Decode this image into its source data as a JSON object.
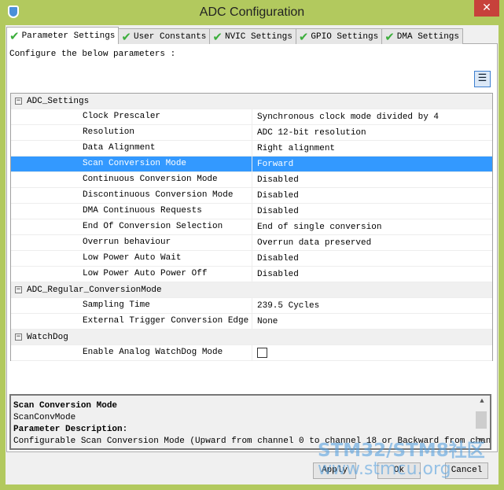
{
  "window": {
    "title": "ADC Configuration",
    "close": "✕"
  },
  "tabs": [
    {
      "label": "Parameter Settings"
    },
    {
      "label": "User Constants"
    },
    {
      "label": "NVIC Settings"
    },
    {
      "label": "GPIO Settings"
    },
    {
      "label": "DMA Settings"
    }
  ],
  "intro": "Configure the below parameters :",
  "groups": [
    {
      "name": "ADC_Settings",
      "params": [
        [
          "Clock Prescaler",
          "Synchronous clock mode divided by 4"
        ],
        [
          "Resolution",
          "ADC 12-bit resolution"
        ],
        [
          "Data Alignment",
          "Right alignment"
        ],
        [
          "Scan Conversion Mode",
          "Forward"
        ],
        [
          "Continuous Conversion Mode",
          "Disabled"
        ],
        [
          "Discontinuous Conversion Mode",
          "Disabled"
        ],
        [
          "DMA Continuous Requests",
          "Disabled"
        ],
        [
          "End Of Conversion Selection",
          "End of single conversion"
        ],
        [
          "Overrun behaviour",
          "Overrun data preserved"
        ],
        [
          "Low Power Auto Wait",
          "Disabled"
        ],
        [
          "Low Power Auto Power Off",
          "Disabled"
        ]
      ]
    },
    {
      "name": "ADC_Regular_ConversionMode",
      "params": [
        [
          "Sampling Time",
          "239.5 Cycles"
        ],
        [
          "External Trigger Conversion Edge",
          "None"
        ]
      ]
    },
    {
      "name": "WatchDog",
      "params": [
        [
          "Enable Analog WatchDog Mode",
          ""
        ]
      ]
    }
  ],
  "selected": "Scan Conversion Mode",
  "watchdog_checked": false,
  "description": {
    "title": "Scan Conversion Mode",
    "id": "ScanConvMode",
    "heading": "Parameter Description:",
    "text": "Configurable Scan Conversion Mode (Upward from channel 0 to channel 18 or Backward from channel"
  },
  "buttons": {
    "apply": "Apply",
    "ok": "Ok",
    "cancel": "Cancel"
  },
  "watermark": {
    "line1": "STM32/STM8社区",
    "line2": "www.stmcu.org"
  },
  "colors": {
    "selection": "#3399ff",
    "frame": "#b2c95e",
    "close": "#c7413b"
  }
}
